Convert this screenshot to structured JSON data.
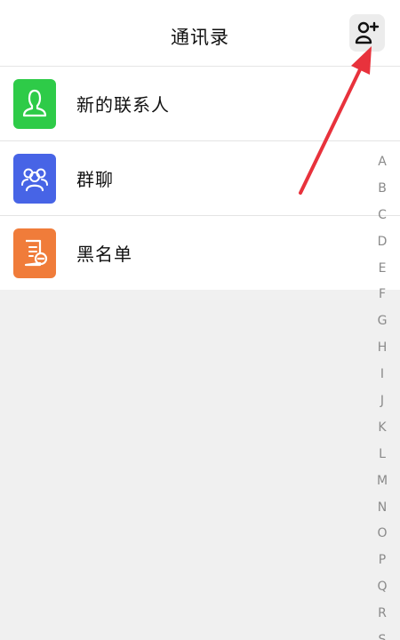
{
  "header": {
    "title": "通讯录",
    "add_contact_icon": "person-add-icon"
  },
  "menu": {
    "items": [
      {
        "label": "新的联系人",
        "icon": "new-contact-icon",
        "color": "#2ecb48"
      },
      {
        "label": "群聊",
        "icon": "group-chat-icon",
        "color": "#4764e6"
      },
      {
        "label": "黑名单",
        "icon": "blacklist-icon",
        "color": "#f07c3a"
      }
    ]
  },
  "alphabet_index": [
    "A",
    "B",
    "C",
    "D",
    "E",
    "F",
    "G",
    "H",
    "I",
    "J",
    "K",
    "L",
    "M",
    "N",
    "O",
    "P",
    "Q",
    "R",
    "S"
  ],
  "annotation": {
    "arrow_color": "#e8323c"
  }
}
